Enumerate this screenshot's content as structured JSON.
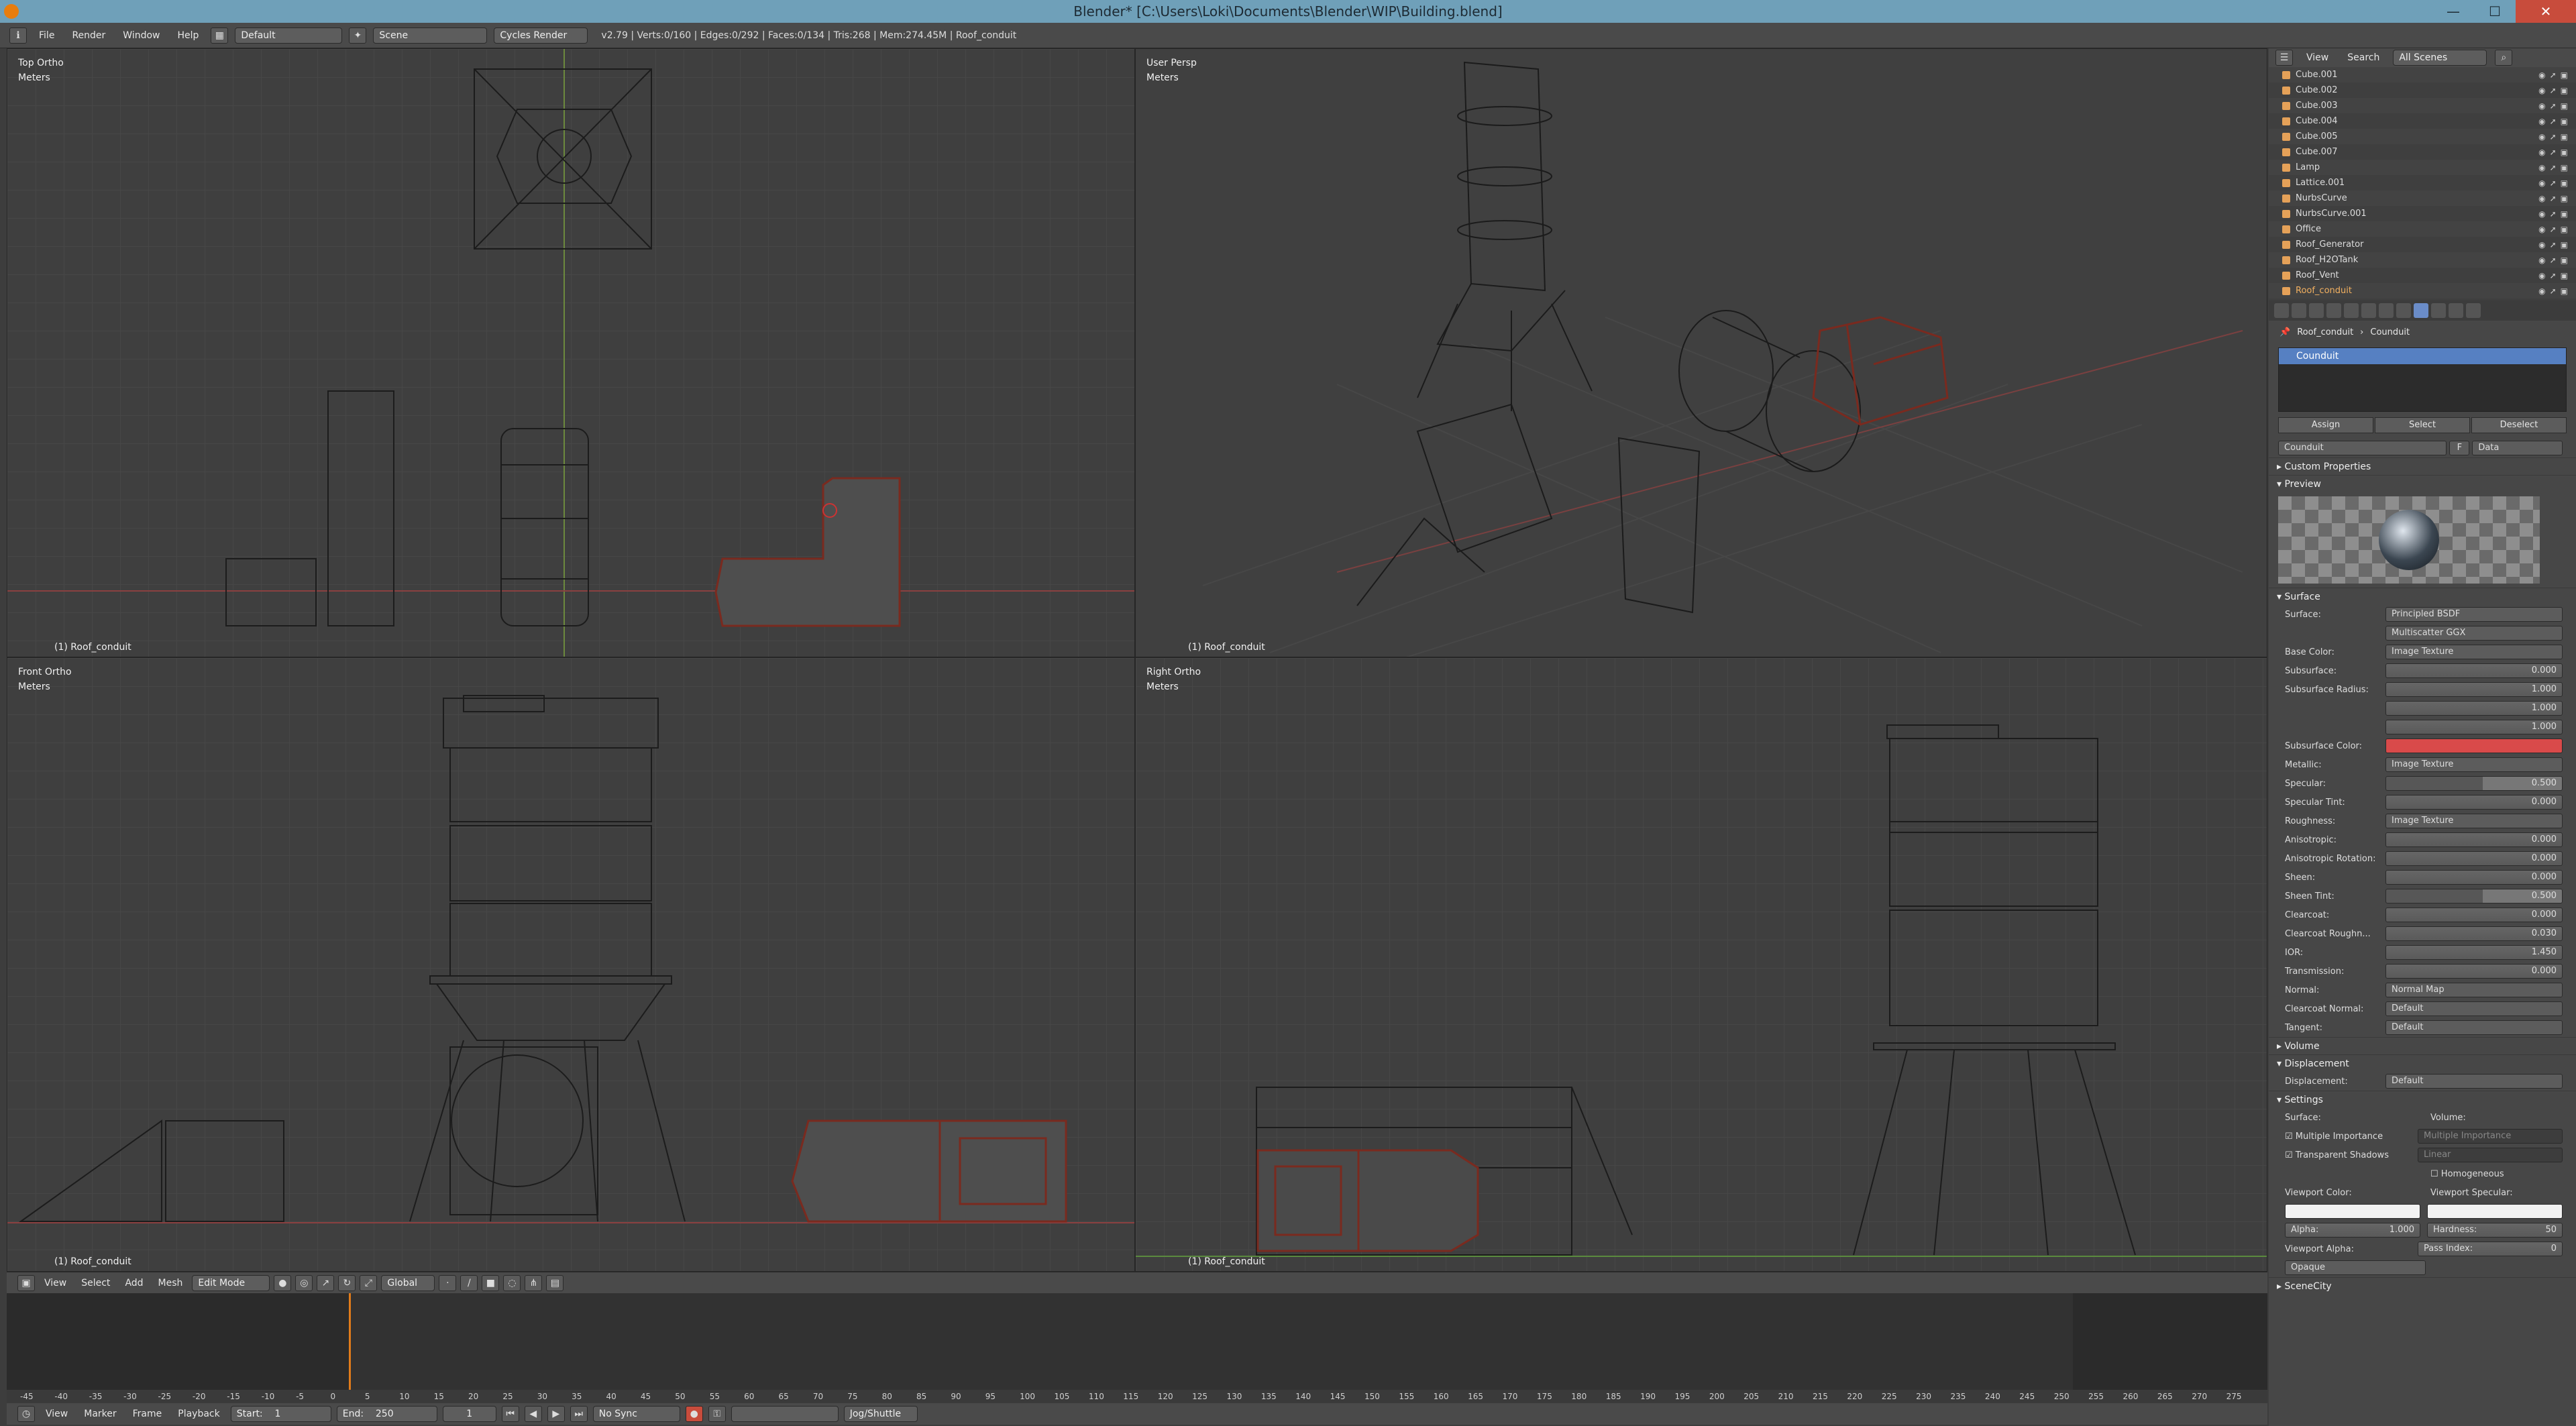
{
  "title": "Blender* [C:\\Users\\Loki\\Documents\\Blender\\WIP\\Building.blend]",
  "window_controls": {
    "minimize": "—",
    "maximize": "☐",
    "close": "✕"
  },
  "menu": [
    "File",
    "Render",
    "Window",
    "Help"
  ],
  "layout": "Default",
  "scene": "Scene",
  "engine": "Cycles Render",
  "stats": "v2.79 | Verts:0/160 | Edges:0/292 | Faces:0/134 | Tris:268 | Mem:274.45M | Roof_conduit",
  "viewports": {
    "top": {
      "name": "Top Ortho",
      "units": "Meters",
      "object": "(1) Roof_conduit"
    },
    "persp": {
      "name": "User Persp",
      "units": "Meters",
      "object": "(1) Roof_conduit"
    },
    "front": {
      "name": "Front Ortho",
      "units": "Meters",
      "object": "(1) Roof_conduit"
    },
    "right": {
      "name": "Right Ortho",
      "units": "Meters",
      "object": "(1) Roof_conduit"
    }
  },
  "view3d_header": {
    "menus": [
      "View",
      "Select",
      "Add",
      "Mesh"
    ],
    "mode": "Edit Mode",
    "orientation": "Global"
  },
  "timeline": {
    "ticks": [
      "-45",
      "-40",
      "-35",
      "-30",
      "-25",
      "-20",
      "-15",
      "-10",
      "-5",
      "0",
      "5",
      "10",
      "15",
      "20",
      "25",
      "30",
      "35",
      "40",
      "45",
      "50",
      "55",
      "60",
      "65",
      "70",
      "75",
      "80",
      "85",
      "90",
      "95",
      "100",
      "105",
      "110",
      "115",
      "120",
      "125",
      "130",
      "135",
      "140",
      "145",
      "150",
      "155",
      "160",
      "165",
      "170",
      "175",
      "180",
      "185",
      "190",
      "195",
      "200",
      "205",
      "210",
      "215",
      "220",
      "225",
      "230",
      "235",
      "240",
      "245",
      "250",
      "255",
      "260",
      "265",
      "270",
      "275"
    ],
    "menus": [
      "View",
      "Marker",
      "Frame",
      "Playback"
    ],
    "start": "Start:",
    "start_val": "1",
    "end": "End:",
    "end_val": "250",
    "current": "1",
    "sync": "No Sync",
    "jog": "Jog/Shuttle"
  },
  "outliner": {
    "menus": [
      "View",
      "Search"
    ],
    "filter": "All Scenes",
    "items": [
      "Cube.001",
      "Cube.002",
      "Cube.003",
      "Cube.004",
      "Cube.005",
      "Cube.007",
      "Lamp",
      "Lattice.001",
      "NurbsCurve",
      "NurbsCurve.001",
      "Office",
      "Roof_Generator",
      "Roof_H2OTank",
      "Roof_Vent",
      "Roof_conduit"
    ]
  },
  "properties": {
    "crumb_object": "Roof_conduit",
    "crumb_material": "Counduit",
    "slot": "Counduit",
    "assign": "Assign",
    "select": "Select",
    "deselect": "Deselect",
    "material_name": "Counduit",
    "fake": "F",
    "link": "Data",
    "panels": {
      "custom": "Custom Properties",
      "preview": "Preview",
      "surface": "Surface",
      "volume": "Volume",
      "displacement": "Displacement",
      "settings": "Settings",
      "scene": "SceneCity"
    },
    "surface_rows": [
      {
        "label": "Surface:",
        "value": "Principled BSDF"
      },
      {
        "label": "",
        "value": "Multiscatter GGX"
      },
      {
        "label": "Base Color:",
        "value": "Image Texture"
      },
      {
        "label": "Subsurface:",
        "value": "0.000"
      },
      {
        "label": "Subsurface Radius:",
        "value": "1.000"
      },
      {
        "label": "",
        "value": "1.000"
      },
      {
        "label": "",
        "value": "1.000"
      },
      {
        "label": "Subsurface Color:",
        "value": ""
      },
      {
        "label": "Metallic:",
        "value": "Image Texture"
      },
      {
        "label": "Specular:",
        "value": "0.500"
      },
      {
        "label": "Specular Tint:",
        "value": "0.000"
      },
      {
        "label": "Roughness:",
        "value": "Image Texture"
      },
      {
        "label": "Anisotropic:",
        "value": "0.000"
      },
      {
        "label": "Anisotropic Rotation:",
        "value": "0.000"
      },
      {
        "label": "Sheen:",
        "value": "0.000"
      },
      {
        "label": "Sheen Tint:",
        "value": "0.500"
      },
      {
        "label": "Clearcoat:",
        "value": "0.000"
      },
      {
        "label": "Clearcoat Roughn...",
        "value": "0.030"
      },
      {
        "label": "IOR:",
        "value": "1.450"
      },
      {
        "label": "Transmission:",
        "value": "0.000"
      },
      {
        "label": "Normal:",
        "value": "Normal Map"
      },
      {
        "label": "Clearcoat Normal:",
        "value": "Default"
      },
      {
        "label": "Tangent:",
        "value": "Default"
      }
    ],
    "displacement_label": "Displacement:",
    "displacement_value": "Default",
    "settings": {
      "surface": "Surface:",
      "volume": "Volume:",
      "mis": "Multiple Importance",
      "shadows": "Transparent Shadows",
      "vol_sampling": "Multiple Importance",
      "vol_interp": "Linear",
      "homogeneous": "Homogeneous",
      "viewport_color": "Viewport Color:",
      "viewport_specular": "Viewport Specular:",
      "alpha": "Alpha:",
      "alpha_val": "1.000",
      "hardness": "Hardness:",
      "hardness_val": "50",
      "viewport_alpha": "Viewport Alpha:",
      "pass_index": "Pass Index:",
      "pass_index_val": "0",
      "blend": "Opaque"
    }
  }
}
